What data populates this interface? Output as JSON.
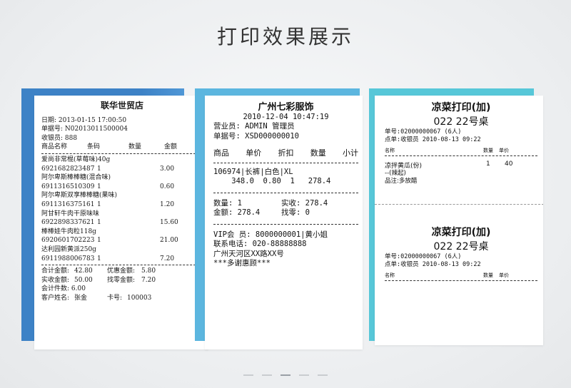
{
  "title": "打印效果展示",
  "receipt1": {
    "store": "联华世贸店",
    "date": "日期: 2013-01-15 17:00:50",
    "bill_no": "单据号: N02013011500004",
    "cashier": "收银员: 888",
    "columns": [
      "商品名称",
      "条码",
      "数量",
      "金额"
    ],
    "items": [
      {
        "name": "爱尚非常棍(草莓味)40g",
        "code": "6921682823487",
        "qty": "1",
        "amount": "3.00"
      },
      {
        "name": "阿尔卑斯棒棒糖(混合味)",
        "code": "6911316510309",
        "qty": "1",
        "amount": "0.60"
      },
      {
        "name": "阿尔卑斯双享棒棒糖(果味)",
        "code": "6911316375161",
        "qty": "1",
        "amount": "1.20"
      },
      {
        "name": "阿甘轩牛肉干原味味",
        "code": "6922898337621",
        "qty": "1",
        "amount": "15.60"
      },
      {
        "name": "棒棒娃牛肉粒118g",
        "code": "6920601702223",
        "qty": "1",
        "amount": "21.00"
      },
      {
        "name": "达利园新黄派250g",
        "code": "6911988006783",
        "qty": "1",
        "amount": "7.20"
      }
    ],
    "totals": [
      [
        "合计金额:",
        "42.80",
        "优惠金额:",
        "5.80"
      ],
      [
        "实收金额:",
        "50.00",
        "找零金额:",
        "7.20"
      ]
    ],
    "points": "会计件数: 6.00",
    "customer": [
      "客户姓名:",
      "张金",
      "卡号:",
      "100003"
    ]
  },
  "receipt2": {
    "store": "广州七彩服饰",
    "date": "2010-12-04 10:47:19",
    "clerk": "营业员: ADMIN 管理员",
    "bill_no": "单据号: XSD000000010",
    "columns": [
      "商品",
      "单价",
      "折扣",
      "数量",
      "小计"
    ],
    "item_line": "106974|长裤|白色|XL",
    "item_values": "    348.0  0.80  1   278.4",
    "qty": "数量: 1",
    "paid": "实收: 278.4",
    "amount": "金额: 278.4",
    "change": "找零: 0",
    "vip": "VIP会 员: 8000000001|黄小姐",
    "phone": "联系电话: 020-88888888",
    "address": "广州天河区XX路XX号",
    "thanks": "***多谢惠顾***"
  },
  "receipt3": {
    "title": "凉菜打印(加)",
    "table": "022 22号桌",
    "order_no": "单号:02000000067 (6人)",
    "cashier_time": "点单:收银员 2010-08-13 09:22",
    "columns": [
      "名称",
      "数量",
      "单价"
    ],
    "dish_name": "凉拌黄瓜(份)",
    "dish_qty": "1",
    "dish_price": "40",
    "dish_note": "--(辣起)",
    "remark": "品注:多放醋",
    "title2": "凉菜打印(加)",
    "table2": "022 22号桌",
    "order_no2": "单号:02000000067 (6人)",
    "cashier_time2": "点单:收银员 2010-08-13 09:22",
    "columns2": [
      "名称",
      "数量",
      "单价"
    ]
  }
}
